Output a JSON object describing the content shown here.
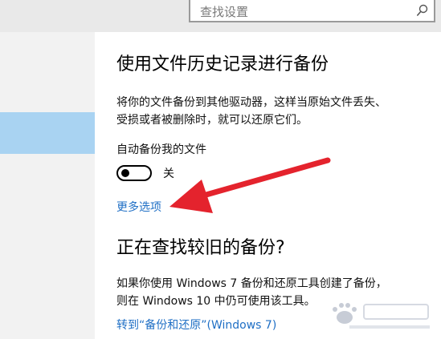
{
  "search": {
    "placeholder": "查找设置"
  },
  "backup": {
    "title": "使用文件历史记录进行备份",
    "description_line1": "将你的文件备份到其他驱动器，这样当原始文件丢失、",
    "description_line2": "受损或者被删除时，就可以还原它们。",
    "auto_backup_label": "自动备份我的文件",
    "toggle_state": "关",
    "toggle_on": false,
    "more_options": "更多选项"
  },
  "old_backup": {
    "title": "正在查找较旧的备份?",
    "description_line1": "如果你使用 Windows 7 备份和还原工具创建了备份，",
    "description_line2": "则在 Windows 10 中仍可使用该工具。",
    "link": "转到“备份和还原”(Windows 7)"
  },
  "colors": {
    "link": "#1f6fc5",
    "selection": "#a9d3f2",
    "arrow": "#e4232d"
  },
  "icons": {
    "search": "search-icon",
    "annotation": "red-arrow-icon",
    "watermark": "baidu-watermark-logo"
  }
}
